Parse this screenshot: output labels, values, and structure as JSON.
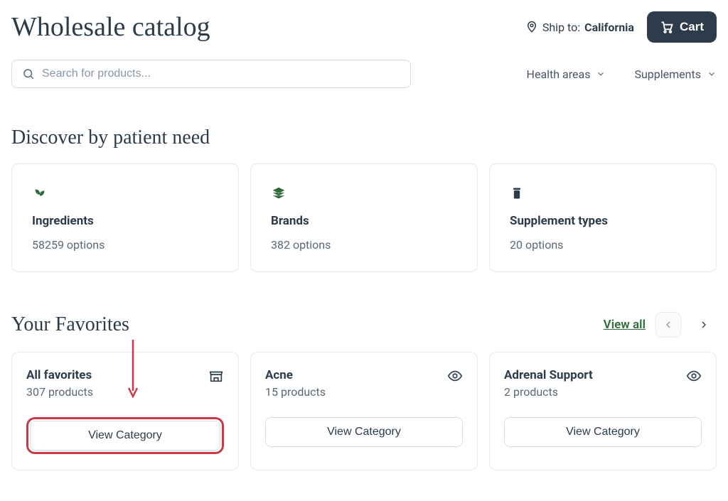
{
  "header": {
    "title_label": "Wholesale catalog",
    "ship_prefix": "Ship to:",
    "ship_region": "California",
    "cart_label": "Cart"
  },
  "search": {
    "placeholder": "Search for products..."
  },
  "nav": {
    "health_areas_label": "Health areas",
    "supplements_label": "Supplements"
  },
  "sections": {
    "discover_heading": "Discover by patient need",
    "favorites_heading": "Your Favorites",
    "view_all_label": "View all"
  },
  "need_cards": [
    {
      "title": "Ingredients",
      "subtitle": "58259 options"
    },
    {
      "title": "Brands",
      "subtitle": "382 options"
    },
    {
      "title": "Supplement types",
      "subtitle": "20 options"
    }
  ],
  "favorites": [
    {
      "title": "All favorites",
      "subtitle": "307 products",
      "button_label": "View Category",
      "highlighted": true
    },
    {
      "title": "Acne",
      "subtitle": "15 products",
      "button_label": "View Category",
      "highlighted": false
    },
    {
      "title": "Adrenal Support",
      "subtitle": "2 products",
      "button_label": "View Category",
      "highlighted": false
    }
  ],
  "colors": {
    "accent_green": "#2f6b3c",
    "dark_slate": "#2d3b4a",
    "highlight_red": "#c63a47"
  }
}
